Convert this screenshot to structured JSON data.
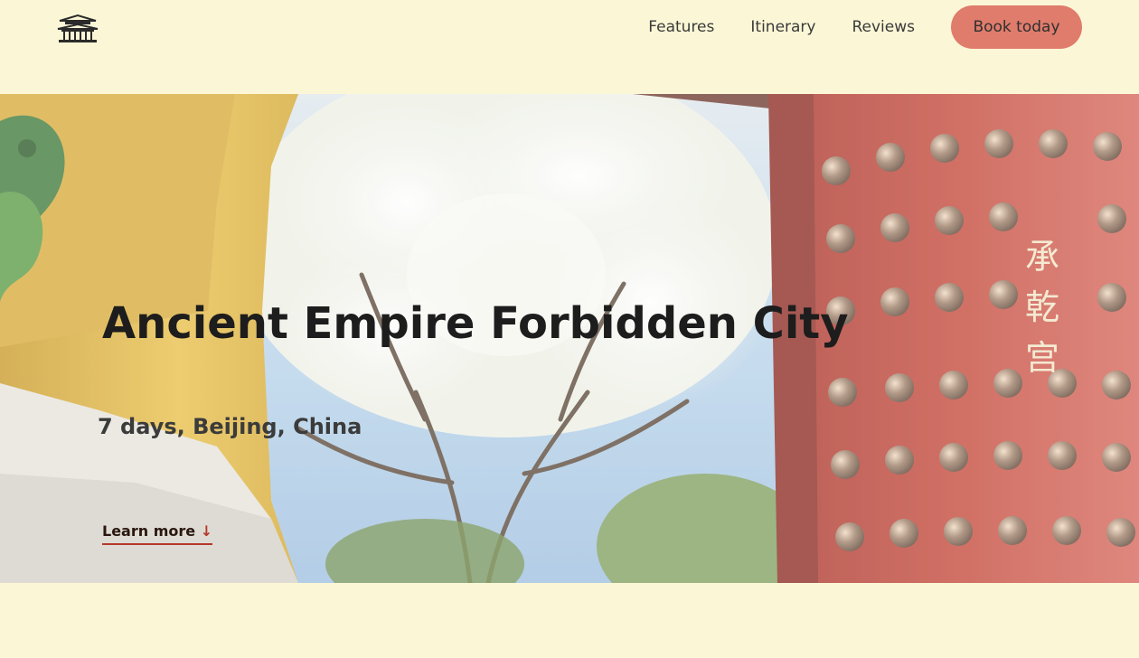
{
  "header": {
    "logo_icon": "palace-icon",
    "nav": [
      {
        "label": "Features"
      },
      {
        "label": "Itinerary"
      },
      {
        "label": "Reviews"
      }
    ],
    "cta_label": "Book today"
  },
  "hero": {
    "title": "Ancient Empire Forbidden City",
    "subtitle": "7 days, Beijing, China",
    "link_label": "Learn more",
    "link_icon": "arrow-down-icon",
    "plaque_chars": [
      "承",
      "乾",
      "宫"
    ]
  },
  "colors": {
    "background": "#fbf7d6",
    "cta": "#e07c6c",
    "accent_red": "#b5382a",
    "wall_red": "#b23a2c",
    "tile_yellow": "#e2b540"
  }
}
